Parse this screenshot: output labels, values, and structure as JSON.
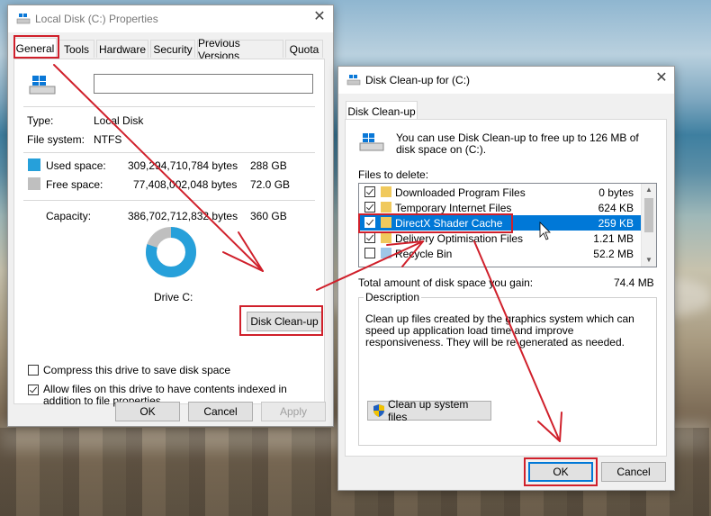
{
  "props": {
    "title": "Local Disk (C:) Properties",
    "tabs": [
      "General",
      "Tools",
      "Hardware",
      "Security",
      "Previous Versions",
      "Quota"
    ],
    "label_value": "",
    "type_label": "Type:",
    "type_value": "Local Disk",
    "fs_label": "File system:",
    "fs_value": "NTFS",
    "used_label": "Used space:",
    "used_bytes": "309,294,710,784 bytes",
    "used_h": "288 GB",
    "free_label": "Free space:",
    "free_bytes": "77,408,002,048 bytes",
    "free_h": "72.0 GB",
    "cap_label": "Capacity:",
    "cap_bytes": "386,702,712,832 bytes",
    "cap_h": "360 GB",
    "drive_label": "Drive C:",
    "cleanup_button": "Disk Clean-up",
    "compress_label": "Compress this drive to save disk space",
    "compress_checked": false,
    "index_label": "Allow files on this drive to have contents indexed in addition to file properties",
    "index_checked": true,
    "ok": "OK",
    "cancel": "Cancel",
    "apply": "Apply",
    "used_fraction": 0.8,
    "colors": {
      "used": "#26a0da",
      "free": "#bfbfbf"
    }
  },
  "cleanup": {
    "title": "Disk Clean-up for  (C:)",
    "tab": "Disk Clean-up",
    "intro": "You can use Disk Clean-up to free up to 126 MB of disk space on  (C:).",
    "files_label": "Files to delete:",
    "files": [
      {
        "name": "Downloaded Program Files",
        "size": "0 bytes",
        "checked": true,
        "selected": false
      },
      {
        "name": "Temporary Internet Files",
        "size": "624 KB",
        "checked": true,
        "selected": false
      },
      {
        "name": "DirectX Shader Cache",
        "size": "259 KB",
        "checked": true,
        "selected": true
      },
      {
        "name": "Delivery Optimisation Files",
        "size": "1.21 MB",
        "checked": true,
        "selected": false
      },
      {
        "name": "Recycle Bin",
        "size": "52.2 MB",
        "checked": false,
        "selected": false
      }
    ],
    "total_label": "Total amount of disk space you gain:",
    "total_value": "74.4 MB",
    "desc_label": "Description",
    "desc_text": "Clean up files created by the graphics system which can speed up application load time and improve responsiveness. They will be re-generated as needed.",
    "cleanup_system": "Clean up system files",
    "ok": "OK",
    "cancel": "Cancel"
  }
}
